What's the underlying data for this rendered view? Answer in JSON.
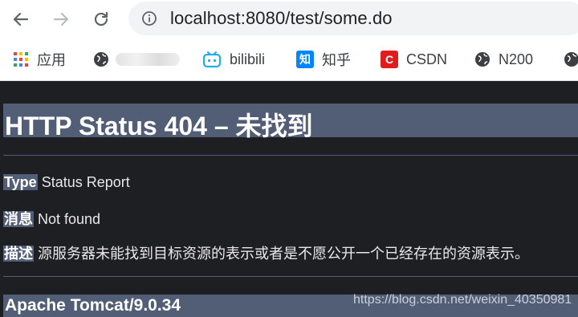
{
  "browser": {
    "url": "localhost:8080/test/some.do",
    "bookmarks": [
      {
        "label": "应用",
        "icon": "apps-grid-icon"
      },
      {
        "label": "",
        "icon": "globe-icon"
      },
      {
        "label": "bilibili",
        "icon": "bilibili-icon"
      },
      {
        "label": "知乎",
        "icon": "zhihu-icon",
        "badge": "知"
      },
      {
        "label": "CSDN",
        "icon": "csdn-icon",
        "badge": "C"
      },
      {
        "label": "N200",
        "icon": "globe-icon"
      }
    ]
  },
  "page": {
    "title": "HTTP Status 404 – 未找到",
    "type_label": "Type",
    "type_value": "Status Report",
    "message_label": "消息",
    "message_value": "Not found",
    "description_label": "描述",
    "description_value": "源服务器未能找到目标资源的表示或者是不愿公开一个已经存在的资源表示。",
    "footer": "Apache Tomcat/9.0.34",
    "watermark": "https://blog.csdn.net/weixin_40350981"
  },
  "colors": {
    "tomcat_bar": "#525d76",
    "page_background": "#1e1f22"
  }
}
